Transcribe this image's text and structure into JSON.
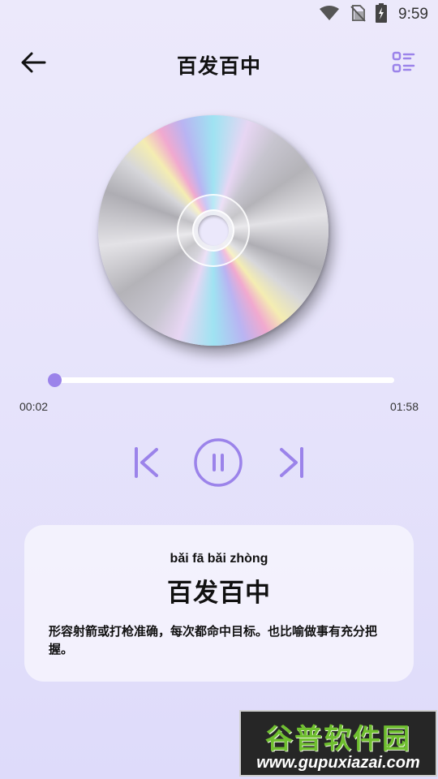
{
  "status_bar": {
    "time": "9:59",
    "icons": [
      "wifi-icon",
      "no-sim-icon",
      "battery-charging-icon"
    ]
  },
  "header": {
    "title": "百发百中",
    "back_icon": "arrow-left-icon",
    "list_icon": "list-icon"
  },
  "player": {
    "disc_icon": "cd-disc",
    "current_time": "00:02",
    "total_time": "01:58",
    "progress": 0.017,
    "accent_color": "#9b83ea",
    "controls": [
      "skip-previous-icon",
      "pause-icon",
      "skip-next-icon"
    ]
  },
  "idiom_card": {
    "pinyin": "bǎi fā bǎi zhòng",
    "word": "百发百中",
    "meaning": "形容射箭或打枪准确，每次都命中目标。也比喻做事有充分把握。"
  },
  "watermark": {
    "logo": "谷普软件园",
    "url": "www.gupuxiazai.com"
  }
}
